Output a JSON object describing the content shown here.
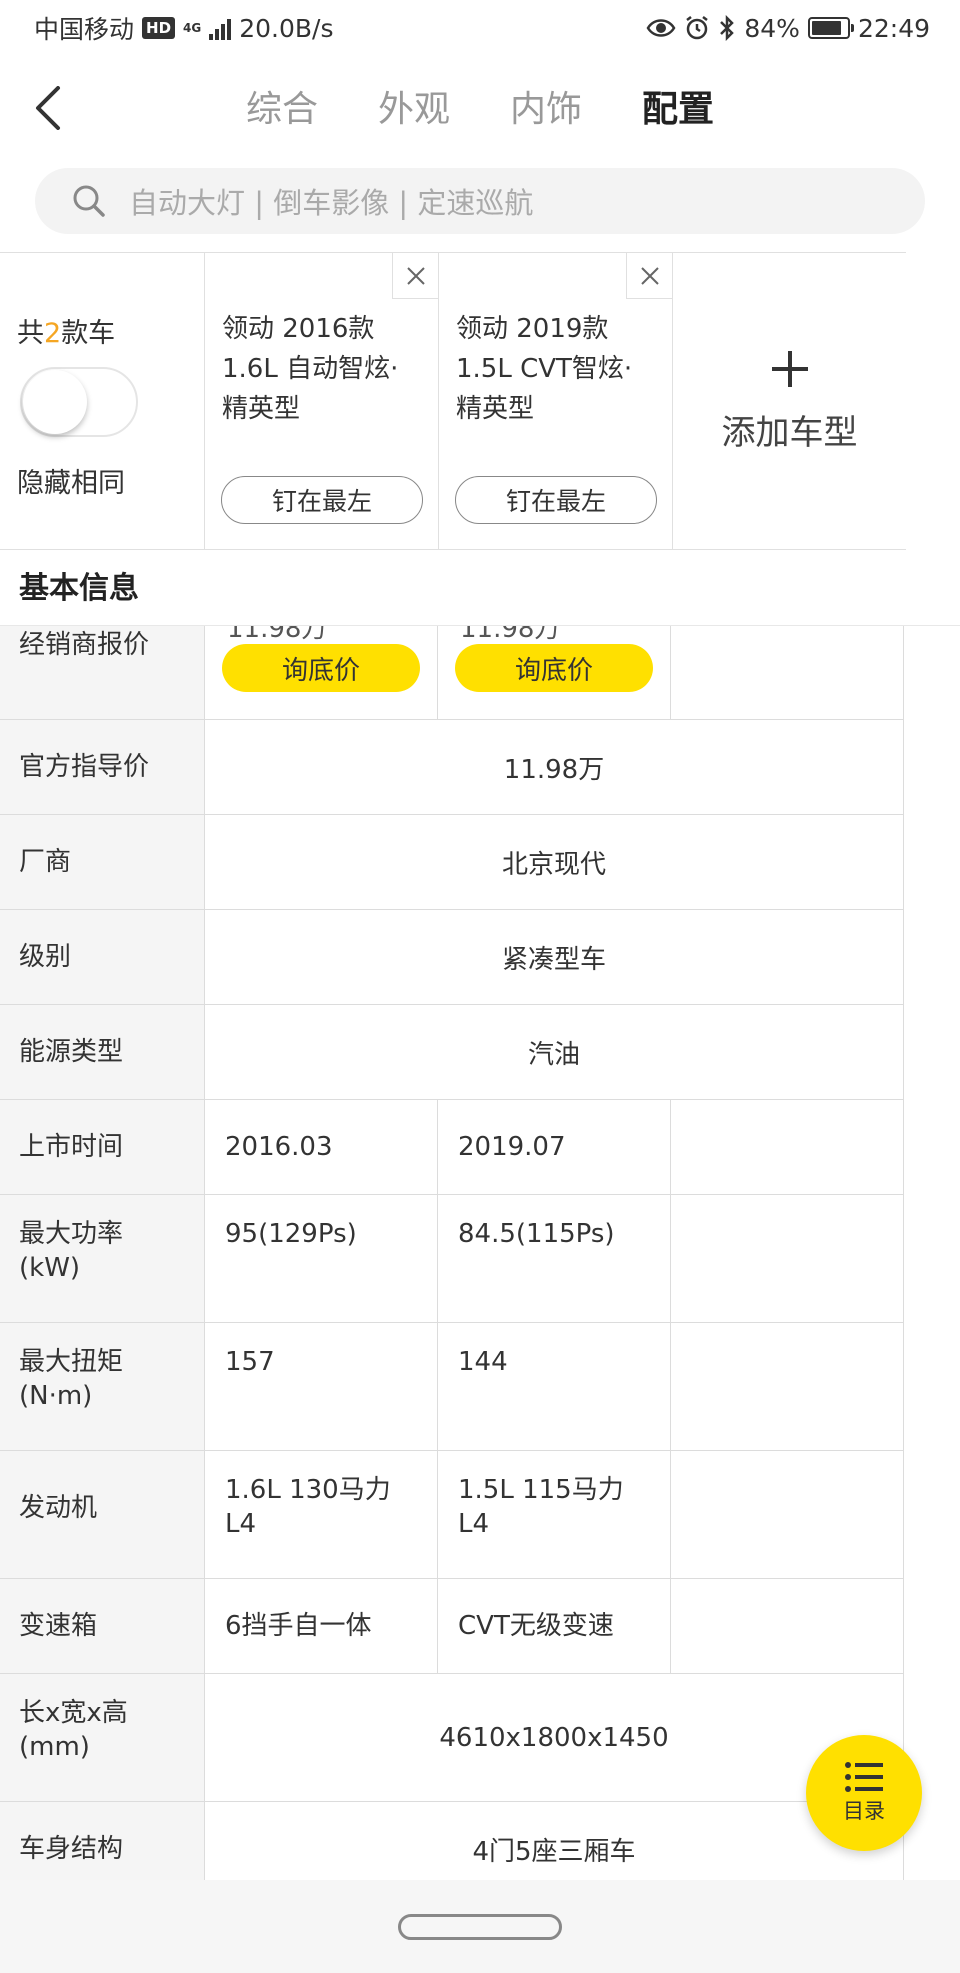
{
  "status_bar": {
    "carrier": "中国移动",
    "hd": "HD",
    "network": "4G",
    "speed": "20.0B/s",
    "battery": "84%",
    "battery_level": 0.84,
    "time": "22:49"
  },
  "nav": {
    "tabs": [
      {
        "label": "综合",
        "active": false
      },
      {
        "label": "外观",
        "active": false
      },
      {
        "label": "内饰",
        "active": false
      },
      {
        "label": "配置",
        "active": true
      }
    ]
  },
  "search": {
    "placeholder": "自动大灯 | 倒车影像 | 定速巡航"
  },
  "compare": {
    "count_prefix": "共",
    "count": "2",
    "count_suffix": "款车",
    "hide_same_label": "隐藏相同",
    "hide_same_on": false,
    "cars": [
      {
        "name": "领动 2016款 1.6L 自动智炫·精英型",
        "pin_label": "钉在最左"
      },
      {
        "name": "领动 2019款 1.5L CVT智炫·精英型",
        "pin_label": "钉在最左"
      }
    ],
    "add_label": "添加车型"
  },
  "section": {
    "title": "基本信息"
  },
  "table": {
    "dealer": {
      "label": "经销商报价",
      "button": "询底价"
    },
    "rows": [
      {
        "label": "官方指导价",
        "merged": "11.98万"
      },
      {
        "label": "厂商",
        "merged": "北京现代"
      },
      {
        "label": "级别",
        "merged": "紧凑型车"
      },
      {
        "label": "能源类型",
        "merged": "汽油"
      },
      {
        "label": "上市时间",
        "values": [
          "2016.03",
          "2019.07"
        ]
      },
      {
        "label": "最大功率\n(kW)",
        "values": [
          "95(129Ps)",
          "84.5(115Ps)"
        ]
      },
      {
        "label": "最大扭矩\n(N·m)",
        "values": [
          "157",
          "144"
        ]
      },
      {
        "label": "发动机",
        "values": [
          "1.6L 130马力\nL4",
          "1.5L 115马力\nL4"
        ]
      },
      {
        "label": "变速箱",
        "values": [
          "6挡手自一体",
          "CVT无级变速"
        ]
      },
      {
        "label": "长x宽x高\n(mm)",
        "merged": "4610x1800x1450"
      },
      {
        "label": "车身结构",
        "merged": "4门5座三厢车"
      }
    ]
  },
  "catalog": {
    "label": "目录"
  },
  "colors": {
    "accent_yellow": "#ffe000",
    "count_orange": "#f5a623"
  }
}
